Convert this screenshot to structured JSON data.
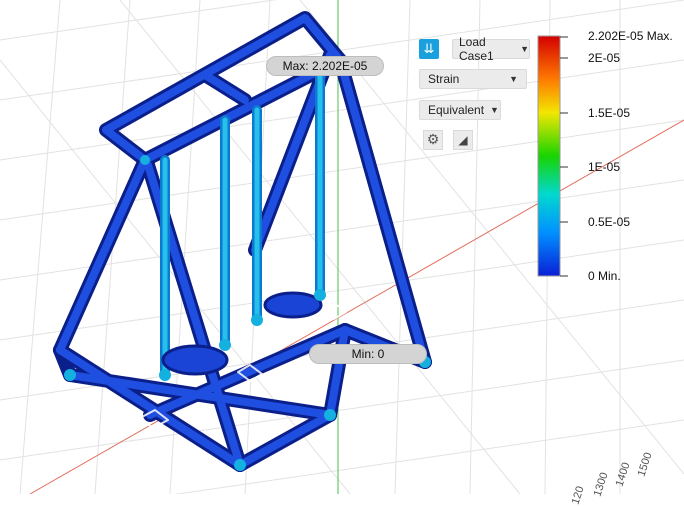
{
  "toolbar": {
    "load_case_label": "Load Case1",
    "result_type": "Strain",
    "component": "Equivalent",
    "icons": [
      "double-chevron-down-icon",
      "gear-icon",
      "triangle-icon"
    ]
  },
  "legend": {
    "max_label": "2.202E-05 Max.",
    "ticks": [
      "2E-05",
      "1.5E-05",
      "1E-05",
      "0.5E-05"
    ],
    "min_label": "0 Min.",
    "colors": [
      "#d40000",
      "#ff7a00",
      "#f2e600",
      "#19d400",
      "#00d9d0",
      "#0090ff",
      "#0a1fd6"
    ]
  },
  "probes": {
    "max": "Max: 2.202E-05",
    "min": "Min: 0"
  },
  "ruler": {
    "labels": [
      "1500",
      "1400",
      "1300",
      "120"
    ]
  },
  "colors": {
    "frame_blue": "#1438c8",
    "frame_dark": "#0b1f8a",
    "cyan": "#19b4e6",
    "accent": "#1aa0dc"
  }
}
